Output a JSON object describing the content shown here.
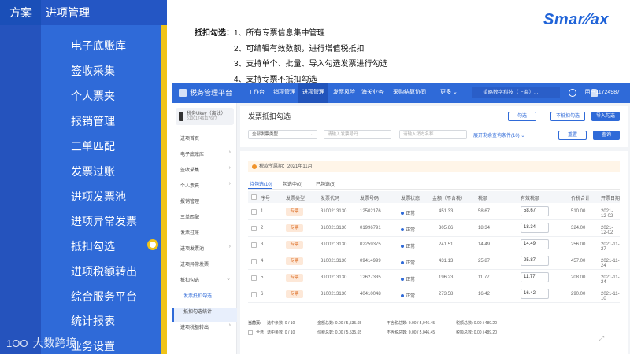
{
  "left_panel": {
    "tab_scheme": "方案",
    "tab_section": "进项管理",
    "nav_items": [
      "电子底账库",
      "签收采集",
      "个人票夹",
      "报销管理",
      "三单匹配",
      "发票过账",
      "进项发票池",
      "进项异常发票",
      "抵扣勾选",
      "进项税额转出",
      "综合服务平台",
      "统计报表",
      "业务设置"
    ],
    "active_item": "抵扣勾选",
    "footer_brand": "大数跨境",
    "footer_icon": "100-logo-icon"
  },
  "intro": {
    "key": "抵扣勾选：",
    "lines": [
      "1、所有专票信息集中管理",
      "2、可编辑有效数额，进行增值税抵扣",
      "3、支持单个、批量、导入勾选发票进行勾选",
      "4、支持专票不抵扣勾选"
    ]
  },
  "logo": "SmartTax",
  "app": {
    "title": "税务管理平台",
    "menus": [
      "工作台",
      "销项管理",
      "进项管理",
      "发票风险",
      "海关业务",
      "采购结算协同",
      "更多"
    ],
    "active_menu": "进项管理",
    "company": "望略数字科技（上海）...",
    "user": "用户11724987",
    "ukey_name": "税务Ukey（离线）",
    "ukey_sn": "51001746117677",
    "side_items": [
      {
        "label": "进项首页",
        "chev": ""
      },
      {
        "label": "电子底账库",
        "chev": "›"
      },
      {
        "label": "签收采集",
        "chev": "›"
      },
      {
        "label": "个人票夹",
        "chev": "›"
      },
      {
        "label": "报销管理",
        "chev": ""
      },
      {
        "label": "三单匹配",
        "chev": ""
      },
      {
        "label": "发票过账",
        "chev": ""
      },
      {
        "label": "进项发票池",
        "chev": "›"
      },
      {
        "label": "进项异常发票",
        "chev": ""
      },
      {
        "label": "抵扣勾选",
        "chev": "⌄"
      },
      {
        "label": "发票抵扣勾选",
        "chev": ""
      },
      {
        "label": "抵扣勾选统计",
        "chev": ""
      },
      {
        "label": "进项税额转出",
        "chev": "›"
      }
    ],
    "page_title": "发票抵扣勾选",
    "buttons": {
      "check": "勾选",
      "no_deduct": "不抵扣勾选",
      "import": "导入勾选",
      "reset": "重置",
      "query": "查询"
    },
    "filters": {
      "type": "全部发票类型",
      "invoice_no_ph": "请输入发票号码",
      "seller_ph": "请输入销方名称",
      "expand": "展开剩余查询条件(10)"
    },
    "period": "税款所属期：2021年11月",
    "tabs": [
      "待勾选(10)",
      "勾选中(0)",
      "已勾选(5)"
    ],
    "columns": [
      "序号",
      "发票类型",
      "发票代码",
      "发票号码",
      "发票状态",
      "金额（不含税）",
      "税额",
      "有效税额",
      "价税合计",
      "开票日期"
    ],
    "rows": [
      {
        "no": "1",
        "type": "专票",
        "code": "3100213130",
        "num": "12502176",
        "status": "正常",
        "amount": "451.33",
        "tax": "58.67",
        "valid": "58.67",
        "total": "510.00",
        "date": "2021-12-02"
      },
      {
        "no": "2",
        "type": "专票",
        "code": "3100213130",
        "num": "01996791",
        "status": "正常",
        "amount": "305.66",
        "tax": "18.34",
        "valid": "18.34",
        "total": "324.00",
        "date": "2021-12-02"
      },
      {
        "no": "3",
        "type": "专票",
        "code": "3100213130",
        "num": "02259375",
        "status": "正常",
        "amount": "241.51",
        "tax": "14.49",
        "valid": "14.49",
        "total": "256.00",
        "date": "2021-11-27"
      },
      {
        "no": "4",
        "type": "专票",
        "code": "3100213130",
        "num": "09414999",
        "status": "正常",
        "amount": "431.13",
        "tax": "25.87",
        "valid": "25.87",
        "total": "457.00",
        "date": "2021-11-24"
      },
      {
        "no": "5",
        "type": "专票",
        "code": "3100213130",
        "num": "12627335",
        "status": "正常",
        "amount": "196.23",
        "tax": "11.77",
        "valid": "11.77",
        "total": "208.00",
        "date": "2021-11-24"
      },
      {
        "no": "6",
        "type": "专票",
        "code": "3100213130",
        "num": "40410048",
        "status": "正常",
        "amount": "273.58",
        "tax": "16.42",
        "valid": "16.42",
        "total": "290.00",
        "date": "2021-11-10"
      }
    ],
    "summary_page": {
      "label": "当前页:",
      "sel": "选中条数: 0 / 10",
      "amt": "金额总数: 0.00 / 5,535.65",
      "tax": "不含税总数: 0.00 / 5,046.45",
      "taxsum": "税额总数: 0.00 / 489.20"
    },
    "summary_all": {
      "label": "全选",
      "sel": "选中条数: 0 / 10",
      "amt": "价税总数: 0.00 / 5,535.65",
      "tax": "不含税总数: 0.00 / 5,046.45",
      "taxsum": "税额总数: 0.00 / 489.20"
    }
  },
  "colors": {
    "primary": "#2f6ad8",
    "accent": "#f0c419",
    "tag": "#e07b39"
  }
}
